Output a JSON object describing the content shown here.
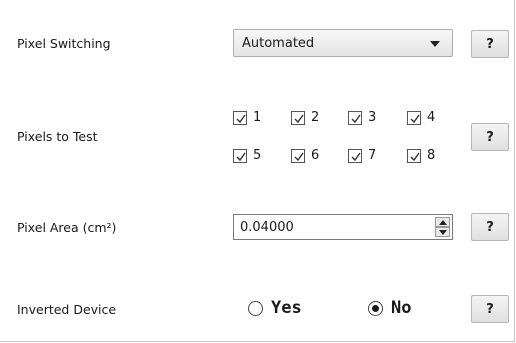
{
  "rows": {
    "pixel_switching": {
      "label": "Pixel Switching",
      "selected": "Automated",
      "help": "?"
    },
    "pixels_to_test": {
      "label": "Pixels to Test",
      "help": "?",
      "pixels": [
        {
          "label": "1",
          "checked": true
        },
        {
          "label": "2",
          "checked": true
        },
        {
          "label": "3",
          "checked": true
        },
        {
          "label": "4",
          "checked": true
        },
        {
          "label": "5",
          "checked": true
        },
        {
          "label": "6",
          "checked": true
        },
        {
          "label": "7",
          "checked": true
        },
        {
          "label": "8",
          "checked": true
        }
      ]
    },
    "pixel_area": {
      "label": "Pixel Area (cm²)",
      "value": "0.04000",
      "help": "?"
    },
    "inverted_device": {
      "label": "Inverted Device",
      "options": [
        {
          "label": "Yes",
          "selected": false
        },
        {
          "label": "No",
          "selected": true
        }
      ],
      "help": "?"
    }
  }
}
